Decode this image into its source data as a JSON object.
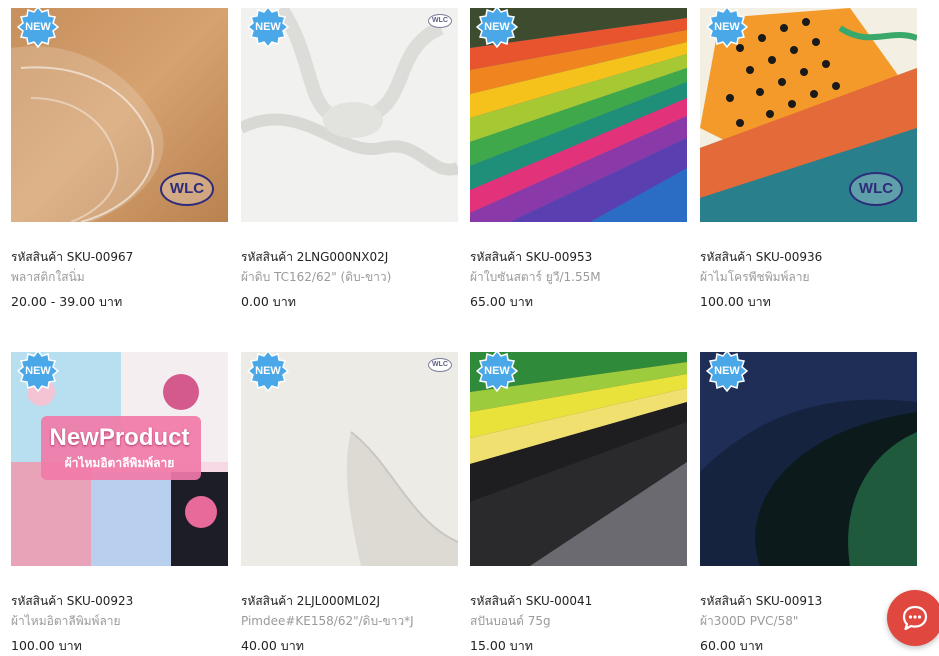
{
  "products": [
    {
      "badge": "NEW",
      "sku": "รหัสสินค้า SKU-00967",
      "name": "พลาสติกใสนิ่ม",
      "price": "20.00 - 39.00 บาท",
      "logo": "WLC"
    },
    {
      "badge": "NEW",
      "sku": "รหัสสินค้า 2LNG000NX02J",
      "name": "ผ้าดิบ TC162/62\" (ดิบ-ขาว)",
      "price": "0.00 บาท",
      "logo": "WLC"
    },
    {
      "badge": "NEW",
      "sku": "รหัสสินค้า SKU-00953",
      "name": "ผ้าใบซันสตาร์ ยูวี/1.55M",
      "price": "65.00 บาท"
    },
    {
      "badge": "NEW",
      "sku": "รหัสสินค้า SKU-00936",
      "name": "ผ้าไมโครพีชพิมพ์ลาย",
      "price": "100.00 บาท",
      "logo": "WLC"
    },
    {
      "badge": "NEW",
      "sku": "รหัสสินค้า SKU-00923",
      "name": "ผ้าไหมอิตาลีพิมพ์ลาย",
      "price": "100.00 บาท",
      "banner_title": "NewProduct",
      "banner_subtitle": "ผ้าไหมอิตาลีพิมพ์ลาย"
    },
    {
      "badge": "NEW",
      "sku": "รหัสสินค้า 2LJL000ML02J",
      "name": "Pimdee#KE158/62\"/ดิบ-ขาว*J",
      "price": "40.00 บาท",
      "logo": "WLC"
    },
    {
      "badge": "NEW",
      "sku": "รหัสสินค้า SKU-00041",
      "name": "สปันบอนด์ 75g",
      "price": "15.00 บาท"
    },
    {
      "badge": "NEW",
      "sku": "รหัสสินค้า SKU-00913",
      "name": "ผ้า300D PVC/58\"",
      "price": "60.00 บาท"
    }
  ],
  "chat_button": {
    "icon": "chat-bubble-icon"
  },
  "colors": {
    "badge": "#4aa8e8",
    "chat": "#e0473e",
    "logo": "#2d2c7a"
  }
}
